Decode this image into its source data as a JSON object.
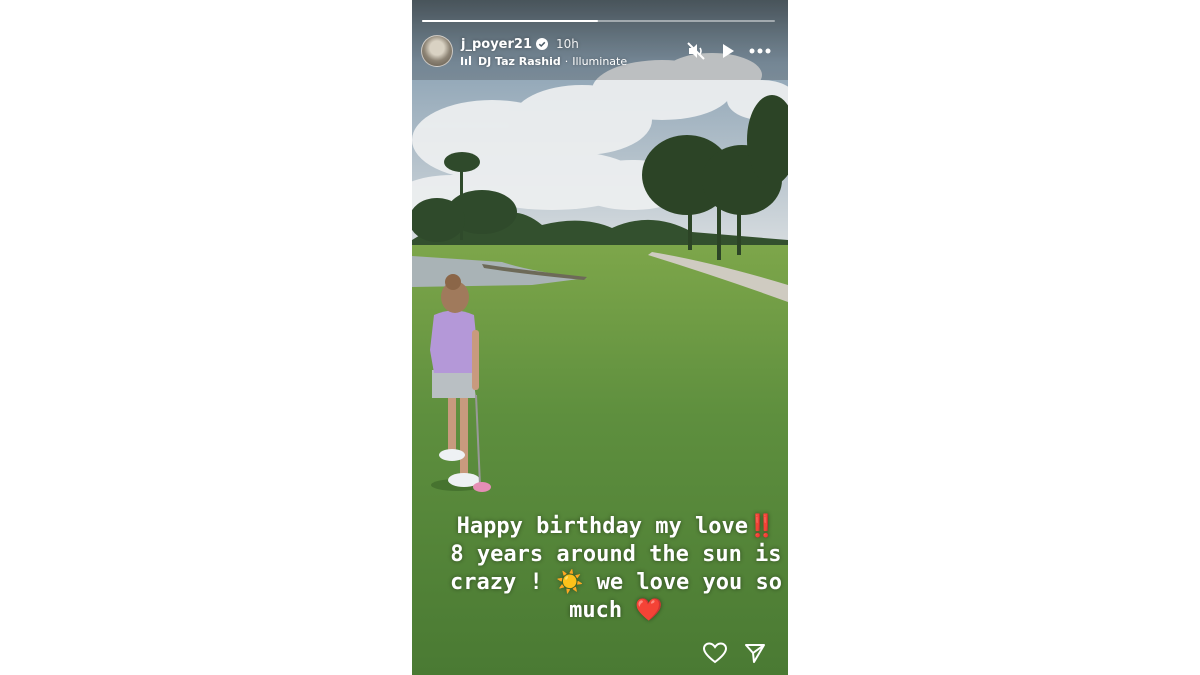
{
  "story": {
    "progress": {
      "segments": 2,
      "current_segment": 1,
      "current_fraction": 1.0
    },
    "user": {
      "username": "j_poyer21",
      "verified": true,
      "timestamp": "10h"
    },
    "music": {
      "artist": "DJ Taz Rashid",
      "separator": "·",
      "track": "Illuminate"
    },
    "controls": {
      "mute_icon": "speaker-muted-icon",
      "play_icon": "play-icon",
      "more_icon": "more-options-icon"
    },
    "caption": {
      "line1": "Happy birthday my love",
      "line1_emoji": "‼️",
      "line2": "8 years around the sun is",
      "line3a": "crazy ! ",
      "line3_emoji": "☀️",
      "line3b": " we love you so",
      "line4": "much ",
      "line4_emoji": "❤️"
    },
    "footer": {
      "like_icon": "heart-outline-icon",
      "share_icon": "send-icon"
    },
    "colors": {
      "accent": "#ffffff",
      "heart": "#e41b2e",
      "bang": "#e02424"
    }
  }
}
